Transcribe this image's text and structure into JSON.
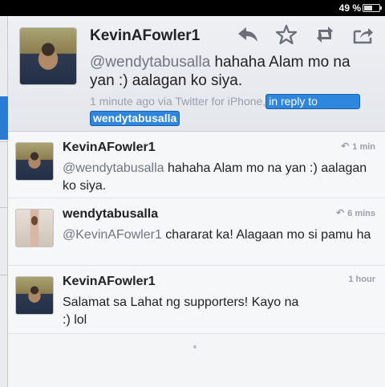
{
  "status": {
    "battery": "49 %",
    "battery_level": 0.49
  },
  "detail": {
    "username": "KevinAFowler1",
    "mention": "@wendytabusalla",
    "text": " hahaha Alam mo na yan :) aalagan ko siya.",
    "time": "1 minute ago",
    "via": "via",
    "client": "Twitter for iPhone,",
    "in_reply_label": "in reply to",
    "in_reply_user": "wendytabusalla",
    "actions": [
      "reply-icon",
      "favorite-icon",
      "retweet-icon",
      "share-icon"
    ]
  },
  "timeline": [
    {
      "username": "KevinAFowler1",
      "time": "1 min",
      "mention": "@wendytabusalla",
      "text": " hahaha Alam mo na yan :) aalagan ko siya.",
      "reply_icon": "reply-indicator-icon"
    },
    {
      "username": "wendytabusalla",
      "time": "6 mins",
      "mention": "@KevinAFowler1",
      "text": " chararat ka! Alagaan mo si pamu ha",
      "reply_icon": "reply-indicator-icon"
    },
    {
      "username": "KevinAFowler1",
      "time": "1 hour",
      "mention": "",
      "text": "Salamat sa Lahat ng supporters! Kayo na :) lol",
      "reply_icon": ""
    }
  ],
  "colors": {
    "accent": "#2e86dd",
    "meta": "#9aa0a8",
    "text": "#222222"
  }
}
